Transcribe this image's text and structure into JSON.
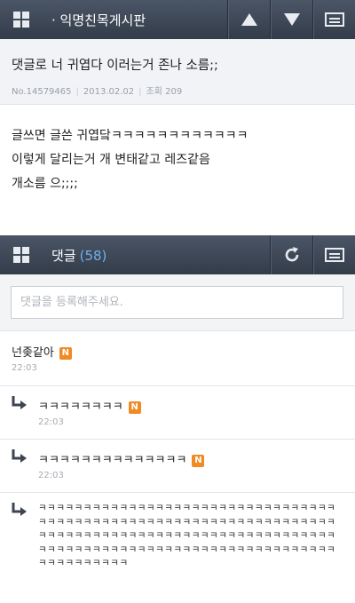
{
  "header": {
    "title": "· 익명친목게시판",
    "icons": [
      "grid-icon",
      "arrow-up-icon",
      "arrow-down-icon",
      "menu-icon"
    ]
  },
  "post": {
    "title": "댓글로 너 귀엽다 이러는거 존나 소름;;",
    "number": "No.14579465",
    "date": "2013.02.02",
    "views": "조회 209",
    "body": [
      "글쓰면 글쓴 귀엽닼ㅋㅋㅋㅋㅋㅋㅋㅋㅋㅋㅋㅋ",
      "이렇게 달리는거 개 변태같고 레즈같음",
      "개소름 으;;;;"
    ]
  },
  "comments_bar": {
    "label": "댓글",
    "count": "(58)",
    "icons": [
      "grid-icon",
      "refresh-icon",
      "menu-icon"
    ]
  },
  "comment_input": {
    "placeholder": "댓글을 등록해주세요."
  },
  "comments": [
    {
      "text": "넌좆같아",
      "badge": "N",
      "time": "22:03",
      "is_reply": false
    },
    {
      "text": "ㅋㅋㅋㅋㅋㅋㅋㅋ",
      "badge": "N",
      "time": "22:03",
      "is_reply": true
    },
    {
      "text": "ㅋㅋㅋㅋㅋㅋㅋㅋㅋㅋㅋㅋㅋㅋ",
      "badge": "N",
      "time": "22:03",
      "is_reply": true
    },
    {
      "text": "ㅋㅋㅋㅋㅋㅋㅋㅋㅋㅋㅋㅋㅋㅋㅋㅋㅋㅋㅋㅋㅋㅋㅋㅋㅋㅋㅋㅋㅋㅋㅋㅋㅋㅋㅋㅋㅋㅋㅋㅋㅋㅋㅋㅋㅋㅋㅋㅋㅋㅋㅋㅋㅋㅋㅋㅋㅋㅋㅋㅋㅋㅋㅋㅋㅋㅋㅋㅋㅋㅋㅋㅋㅋㅋㅋㅋㅋㅋㅋㅋㅋㅋㅋㅋㅋㅋㅋㅋㅋㅋㅋㅋㅋㅋㅋㅋㅋㅋㅋㅋㅋㅋㅋㅋㅋㅋㅋㅋㅋㅋㅋㅋㅋㅋㅋㅋㅋㅋㅋㅋㅋㅋㅋㅋㅋㅋㅋㅋㅋㅋㅋㅋㅋㅋㅋㅋㅋㅋㅋㅋㅋㅋ",
      "is_reply": true
    }
  ],
  "colors": {
    "bar_top": "#4a5566",
    "bar_bottom": "#333c49",
    "badge": "#f08a24",
    "count": "#6fb1ec"
  }
}
